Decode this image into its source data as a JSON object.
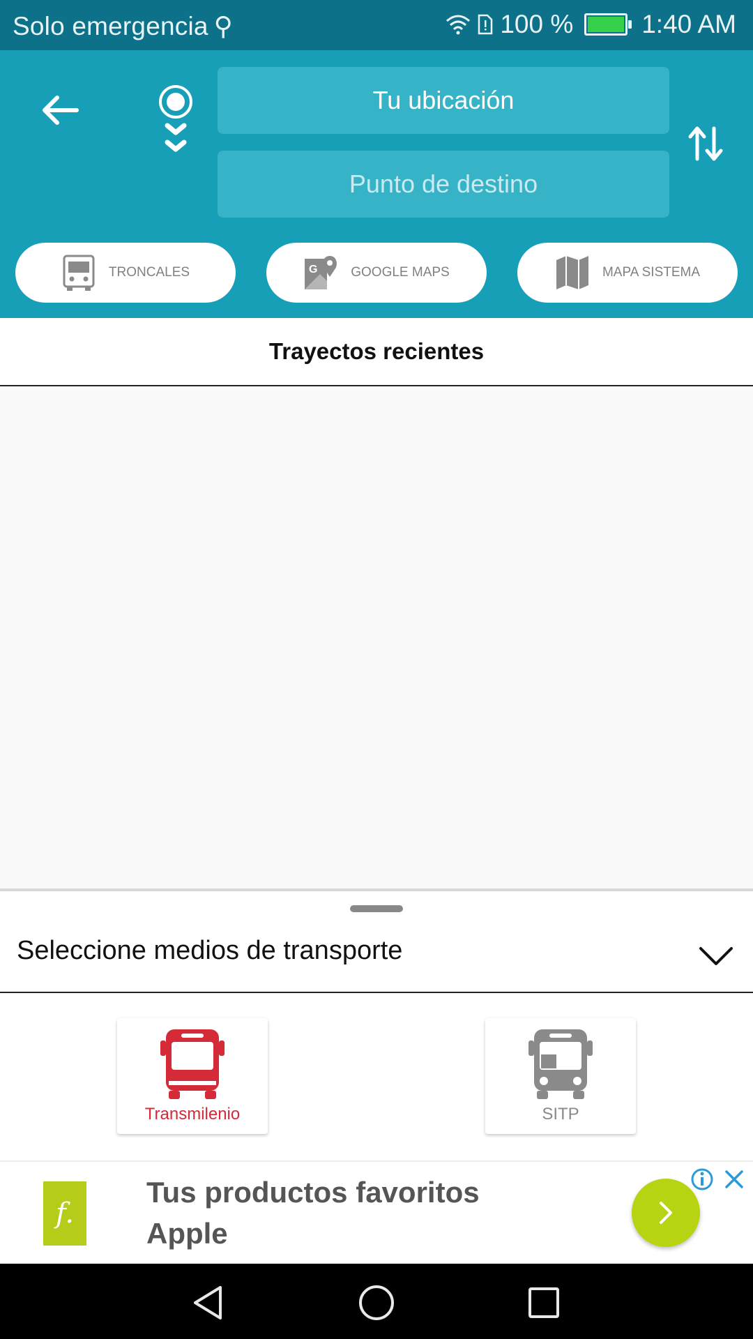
{
  "status_bar": {
    "carrier": "Solo emergencia",
    "battery_percent": "100 %",
    "time": "1:40 AM",
    "battery_color": "#37d04b"
  },
  "header": {
    "background": "#179fb8",
    "origin_placeholder": "Tu ubicación",
    "destination_placeholder": "Punto de destino",
    "chips": [
      {
        "label": "TRONCALES",
        "icon": "bus-front-icon"
      },
      {
        "label": "GOOGLE MAPS",
        "icon": "google-maps-icon"
      },
      {
        "label": "MAPA SISTEMA",
        "icon": "folded-map-icon"
      }
    ]
  },
  "recent": {
    "title": "Trayectos recientes",
    "items": []
  },
  "transport_sheet": {
    "title": "Seleccione medios de transporte",
    "modes": [
      {
        "label": "Transmilenio",
        "selected": true,
        "color": "#d52a37",
        "icon": "bus-icon"
      },
      {
        "label": "SITP",
        "selected": false,
        "color": "#8a8a8a",
        "icon": "bus-icon"
      }
    ]
  },
  "ad": {
    "text_line1": "Tus productos favoritos",
    "text_line2": "Apple",
    "logo_letter": "f.",
    "accent": "#b8d312"
  }
}
